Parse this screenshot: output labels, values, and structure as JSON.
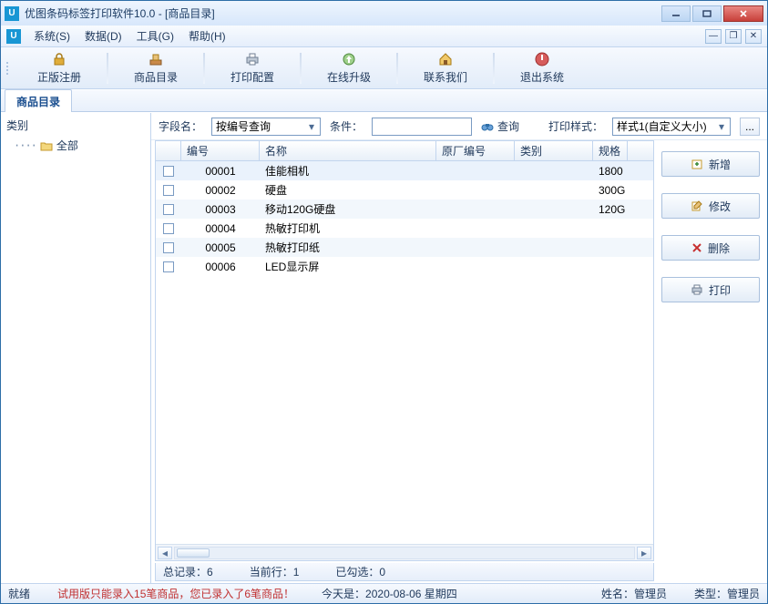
{
  "window": {
    "title": "优图条码标签打印软件10.0 - [商品目录]"
  },
  "menubar": {
    "items": [
      "系统(S)",
      "数据(D)",
      "工具(G)",
      "帮助(H)"
    ]
  },
  "toolbar": {
    "items": [
      {
        "label": "正版注册"
      },
      {
        "label": "商品目录"
      },
      {
        "label": "打印配置"
      },
      {
        "label": "在线升级"
      },
      {
        "label": "联系我们"
      },
      {
        "label": "退出系统"
      }
    ]
  },
  "tab": "商品目录",
  "sidebar": {
    "title": "类别",
    "root": "全部"
  },
  "filter": {
    "field_label": "字段名：",
    "field_value": "按编号查询",
    "cond_label": "条件：",
    "cond_value": "",
    "search": "查询",
    "style_label": "打印样式：",
    "style_value": "样式1(自定义大小)",
    "more": "..."
  },
  "grid": {
    "headers": [
      "编号",
      "名称",
      "原厂编号",
      "类别",
      "规格"
    ],
    "rows": [
      {
        "id": "00001",
        "name": "佳能相机",
        "orig": "",
        "cat": "",
        "spec": "1800"
      },
      {
        "id": "00002",
        "name": "硬盘",
        "orig": "",
        "cat": "",
        "spec": "300G"
      },
      {
        "id": "00003",
        "name": "移动120G硬盘",
        "orig": "",
        "cat": "",
        "spec": "120G"
      },
      {
        "id": "00004",
        "name": "热敏打印机",
        "orig": "",
        "cat": "",
        "spec": ""
      },
      {
        "id": "00005",
        "name": "热敏打印纸",
        "orig": "",
        "cat": "",
        "spec": ""
      },
      {
        "id": "00006",
        "name": "LED显示屏",
        "orig": "",
        "cat": "",
        "spec": ""
      }
    ],
    "status": {
      "total_label": "总记录：",
      "total_value": "6",
      "current_label": "当前行：",
      "current_value": "1",
      "checked_label": "已勾选：",
      "checked_value": "0"
    }
  },
  "actions": {
    "add": "新增",
    "edit": "修改",
    "del": "删除",
    "print": "打印"
  },
  "statusbar": {
    "ready": "就绪",
    "trial": "试用版只能录入15笔商品，您已录入了6笔商品！",
    "today": "今天是：2020-08-06 星期四",
    "name_label": "姓名：",
    "name_value": "管理员",
    "type_label": "类型：",
    "type_value": "管理员"
  }
}
